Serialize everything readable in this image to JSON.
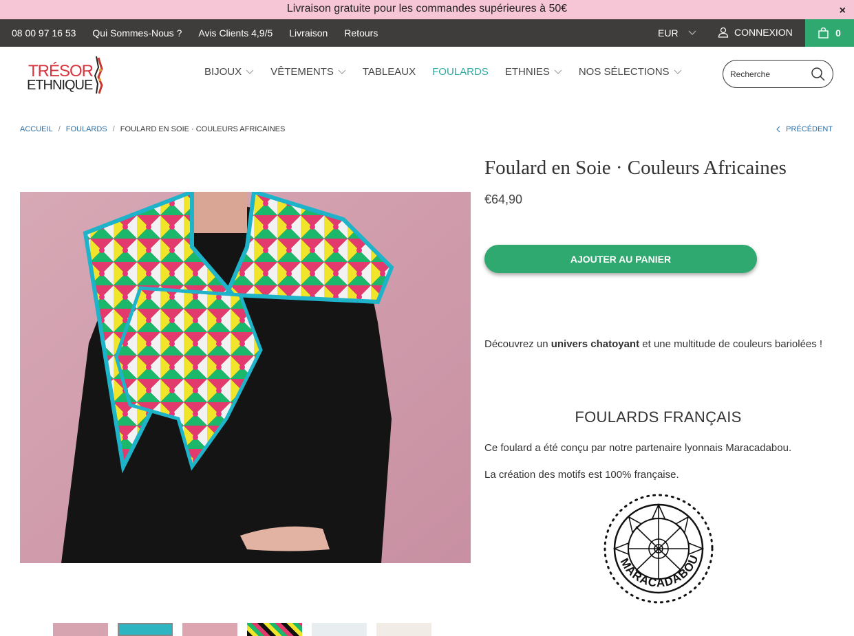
{
  "promo": {
    "text": "Livraison gratuite pour les commandes supérieures à 50€",
    "close": "×"
  },
  "topbar": {
    "links": [
      "08 00 97 16 53",
      "Qui Sommes-Nous ?",
      "Avis Clients 4,9/5",
      "Livraison",
      "Retours"
    ],
    "currency": "EUR",
    "login": "CONNEXION",
    "cart_count": "0"
  },
  "logo": {
    "line1": "TRÉSOR",
    "line2": "ETHNIQUE"
  },
  "nav": {
    "items": [
      {
        "label": "BIJOUX",
        "dropdown": true
      },
      {
        "label": "VÊTEMENTS",
        "dropdown": true
      },
      {
        "label": "TABLEAUX",
        "dropdown": false
      },
      {
        "label": "FOULARDS",
        "dropdown": false,
        "active": true
      },
      {
        "label": "ETHNIES",
        "dropdown": true
      },
      {
        "label": "NOS SÉLECTIONS",
        "dropdown": true
      }
    ]
  },
  "search": {
    "placeholder": "Recherche"
  },
  "breadcrumb": {
    "home": "ACCUEIL",
    "category": "FOULARDS",
    "current": "FOULARD EN SOIE · COULEURS AFRICAINES",
    "separator": "/"
  },
  "prev_link": "PRÉCÉDENT",
  "product": {
    "title": "Foulard en Soie · Couleurs Africaines",
    "price": "€64,90",
    "add_to_cart": "AJOUTER AU PANIER",
    "desc_before": "Découvrez un ",
    "desc_bold": "univers chatoyant",
    "desc_after": " et une multitude de couleurs bariolées !",
    "section_title": "FOULARDS FRANÇAIS",
    "para1": "Ce foulard a été conçu par notre partenaire lyonnais Maracadabou.",
    "para2": "La création des motifs est 100% française.",
    "partner_logo_text": "MARACADABOU"
  },
  "colors": {
    "accent_green": "#2fa96f",
    "promo_pink": "#f6c6d7",
    "topbar_dark": "#3f3c3c",
    "active_nav": "#2fa9a0",
    "link_blue": "#2a6fa8"
  }
}
